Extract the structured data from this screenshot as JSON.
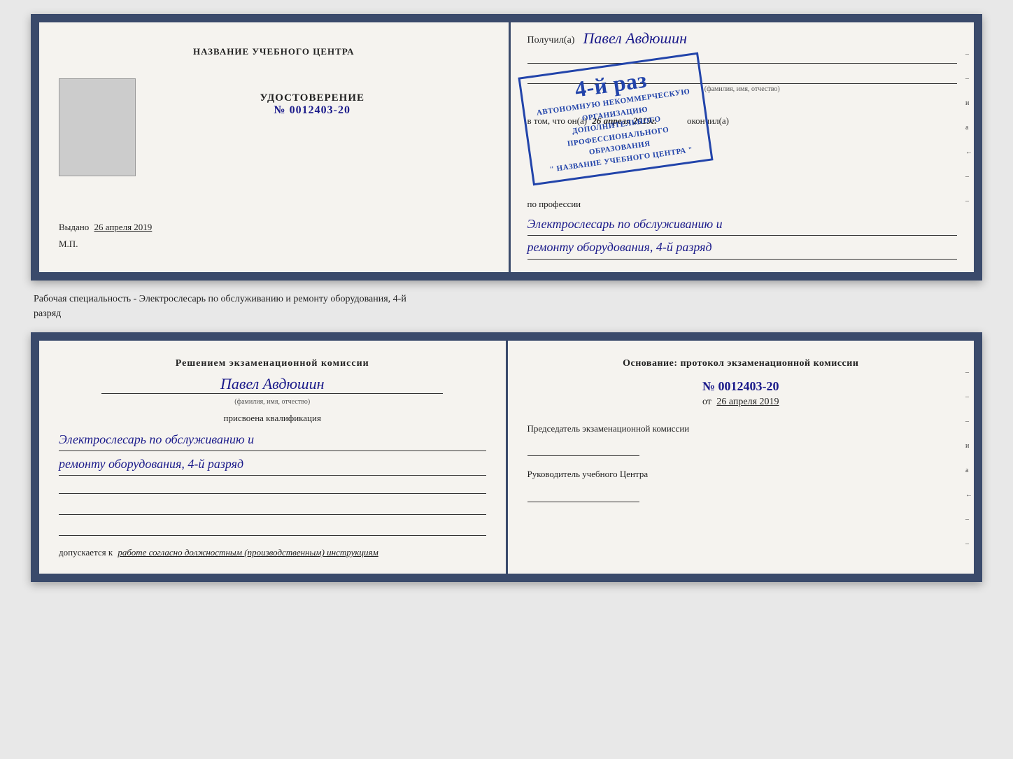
{
  "top_doc": {
    "left": {
      "center_title": "НАЗВАНИЕ УЧЕБНОГО ЦЕНТРА",
      "cert_label": "УДОСТОВЕРЕНИЕ",
      "cert_number": "№ 0012403-20",
      "issued_text": "Выдано",
      "issued_date": "26 апреля 2019",
      "mp_label": "М.П."
    },
    "right": {
      "received_prefix": "Получил(а)",
      "received_name": "Павел Авдюшин",
      "fio_label": "(фамилия, имя, отчество)",
      "vtom_prefix": "в том, что он(а)",
      "vtom_date": "26 апреля 2019г.",
      "okonchil": "окончил(а)",
      "stamp_line1": "АВТОНОМНУЮ НЕКОММЕРЧЕСКУЮ ОРГАНИЗАЦИЮ",
      "stamp_line2": "ДОПОЛНИТЕЛЬНОГО ПРОФЕССИОНАЛЬНОГО ОБРАЗОВАНИЯ",
      "stamp_line3": "\" НАЗВАНИЕ УЧЕБНОГО ЦЕНТРА \"",
      "stamp_grade": "4-й раз",
      "profession_label": "по профессии",
      "profession_line1": "Электрослесарь по обслуживанию и",
      "profession_line2": "ремонту оборудования, 4-й разряд"
    }
  },
  "separator": {
    "text_line1": "Рабочая специальность - Электрослесарь по обслуживанию и ремонту оборудования, 4-й",
    "text_line2": "разряд"
  },
  "bottom_doc": {
    "left": {
      "commission_title": "Решением экзаменационной комиссии",
      "person_name": "Павел Авдюшин",
      "fio_label": "(фамилия, имя, отчество)",
      "assigned_label": "присвоена квалификация",
      "qualification_line1": "Электрослесарь по обслуживанию и",
      "qualification_line2": "ремонту оборудования, 4-й разряд",
      "допускается_prefix": "допускается к",
      "допускается_italic": "работе согласно должностным (производственным) инструкциям"
    },
    "right": {
      "osnov_label": "Основание: протокол экзаменационной комиссии",
      "protocol_number": "№  0012403-20",
      "from_prefix": "от",
      "from_date": "26 апреля 2019",
      "chairman_label": "Председатель экзаменационной комиссии",
      "director_label": "Руководитель учебного Центра"
    }
  },
  "side_labels": {
    "и": "и",
    "a": "a",
    "left": "←",
    "dashes": [
      "–",
      "–",
      "–",
      "–",
      "–",
      "–",
      "–",
      "–"
    ]
  }
}
